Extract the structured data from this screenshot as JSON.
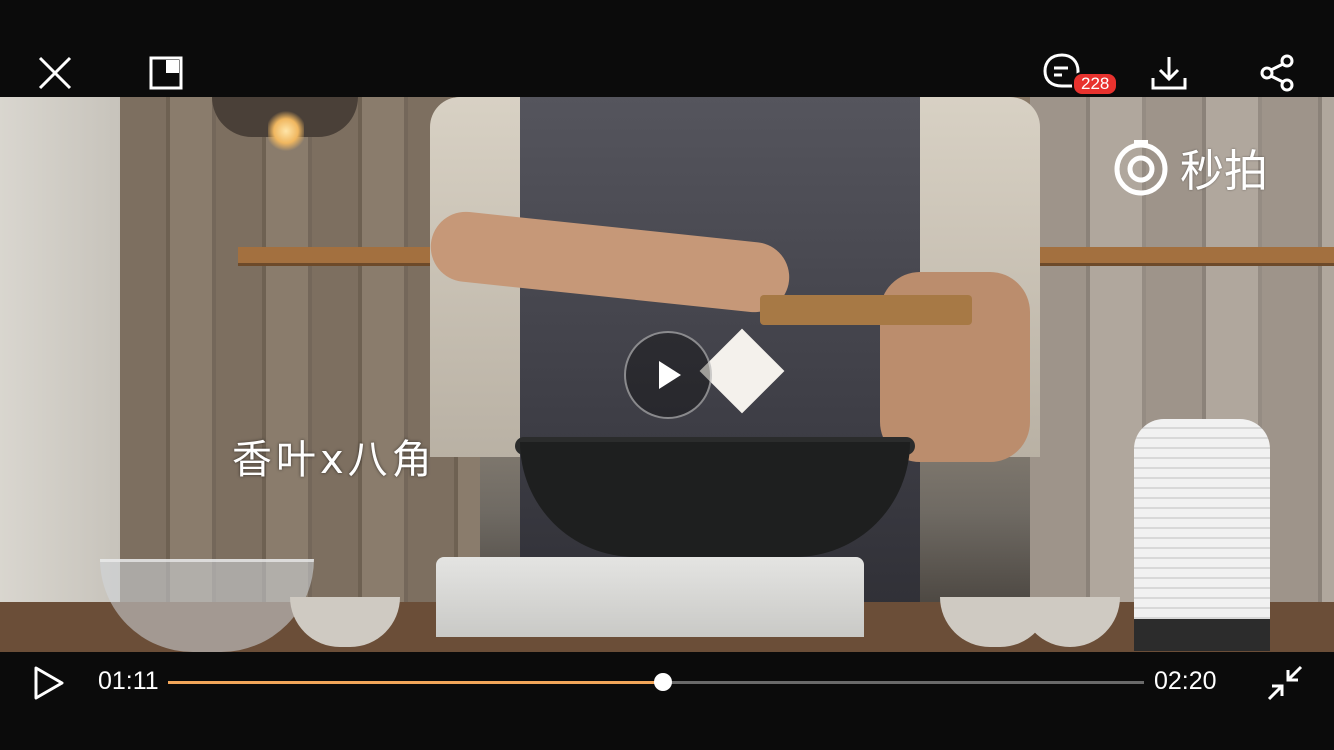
{
  "top_bar": {
    "comment_count": "228",
    "icons": [
      "close-icon",
      "picture-in-picture-icon",
      "comment-icon",
      "download-icon",
      "share-icon"
    ]
  },
  "video": {
    "caption": "香叶x八角",
    "watermark": "秒拍"
  },
  "controls": {
    "current_time": "01:11",
    "total_time": "02:20",
    "progress_fraction": 0.507,
    "accent_color": "#f2a65a"
  }
}
